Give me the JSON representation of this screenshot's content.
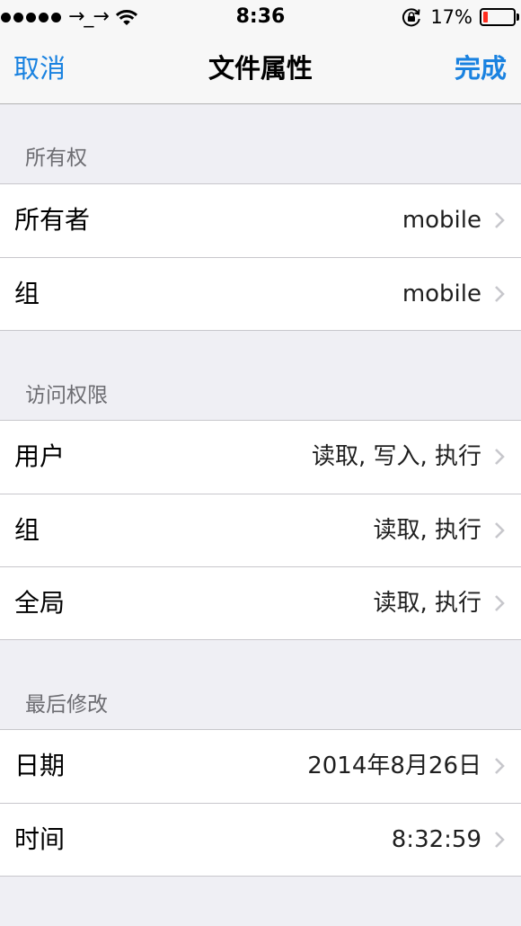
{
  "status_bar": {
    "carrier": "→_→",
    "time": "8:36",
    "battery_percent": "17%",
    "battery_level": 0.17,
    "battery_color": "#ff2d1f",
    "icons": [
      "signal-dots",
      "wifi-icon",
      "rotation-lock-icon",
      "battery-icon"
    ]
  },
  "nav": {
    "cancel_label": "取消",
    "title": "文件属性",
    "done_label": "完成",
    "accent_color": "#1a82e0"
  },
  "sections": {
    "ownership": {
      "header": "所有权",
      "rows": [
        {
          "label": "所有者",
          "value": "mobile"
        },
        {
          "label": "组",
          "value": "mobile"
        }
      ]
    },
    "permissions": {
      "header": "访问权限",
      "rows": [
        {
          "label": "用户",
          "value": "读取, 写入, 执行"
        },
        {
          "label": "组",
          "value": "读取, 执行"
        },
        {
          "label": "全局",
          "value": "读取, 执行"
        }
      ]
    },
    "modified": {
      "header": "最后修改",
      "rows": [
        {
          "label": "日期",
          "value": "2014年8月26日"
        },
        {
          "label": "时间",
          "value": "8:32:59"
        }
      ]
    }
  }
}
